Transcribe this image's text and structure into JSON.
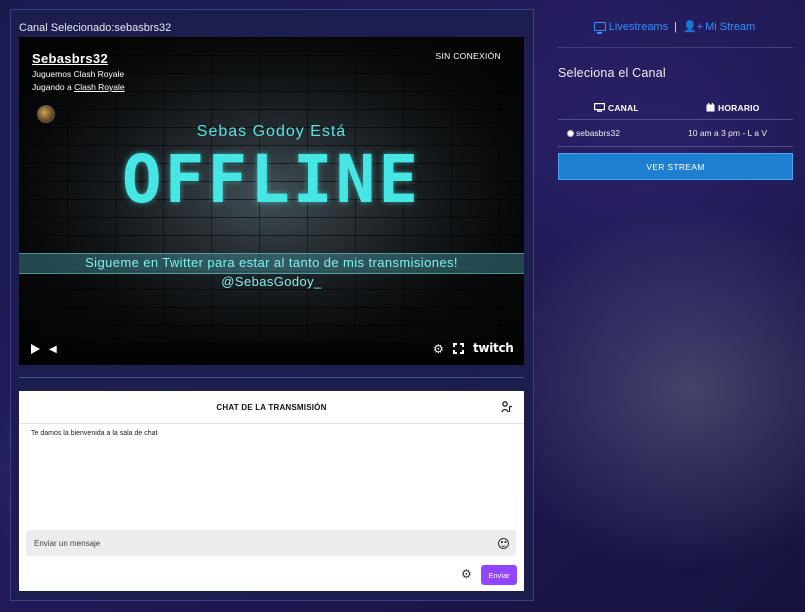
{
  "left": {
    "selected_channel": "Canal Selecionado:sebasbrs32"
  },
  "player": {
    "channel_name": "Sebasbrs32",
    "stream_title": "Juguemos Clash Royale",
    "playing_prefix": "Jugando a",
    "game_link": "Clash Royale",
    "status_badge": "SIN CONEXIÓN",
    "offline_subtitle": "Sebas Godoy Está",
    "offline_big": "OFFLINE",
    "twitter_line": "Sigueme en Twitter para estar al tanto de mis transmisiones!",
    "twitter_handle": "@SebasGodoy_",
    "controls": {
      "volume_icon": "◀",
      "settings_icon": "⚙",
      "twitch_logo": "twitch"
    }
  },
  "chat": {
    "title": "CHAT DE LA TRANSMISIÓN",
    "welcome": "Te damos la bienvenida a la sala de chat",
    "input_placeholder": "Enviar un mensaje",
    "settings_icon": "⚙",
    "send_label": "Enviar"
  },
  "right": {
    "links": {
      "livestreams": "Livestreams",
      "separator": "|",
      "my_stream": "Mi Stream",
      "my_stream_icon": "👤+"
    },
    "select_title": "Seleciona el Canal",
    "columns": {
      "channel": "CANAL",
      "schedule": "HORARIO"
    },
    "rows": [
      {
        "channel": "sebasbrs32",
        "schedule": "10 am a 3 pm - L a V"
      }
    ],
    "watch_button": "VER STREAM"
  },
  "colors": {
    "accent_blue": "#1e7fd0",
    "link_blue": "#2f8fff",
    "twitch_purple": "#9147ff",
    "offline_cyan": "#46e6e4"
  }
}
